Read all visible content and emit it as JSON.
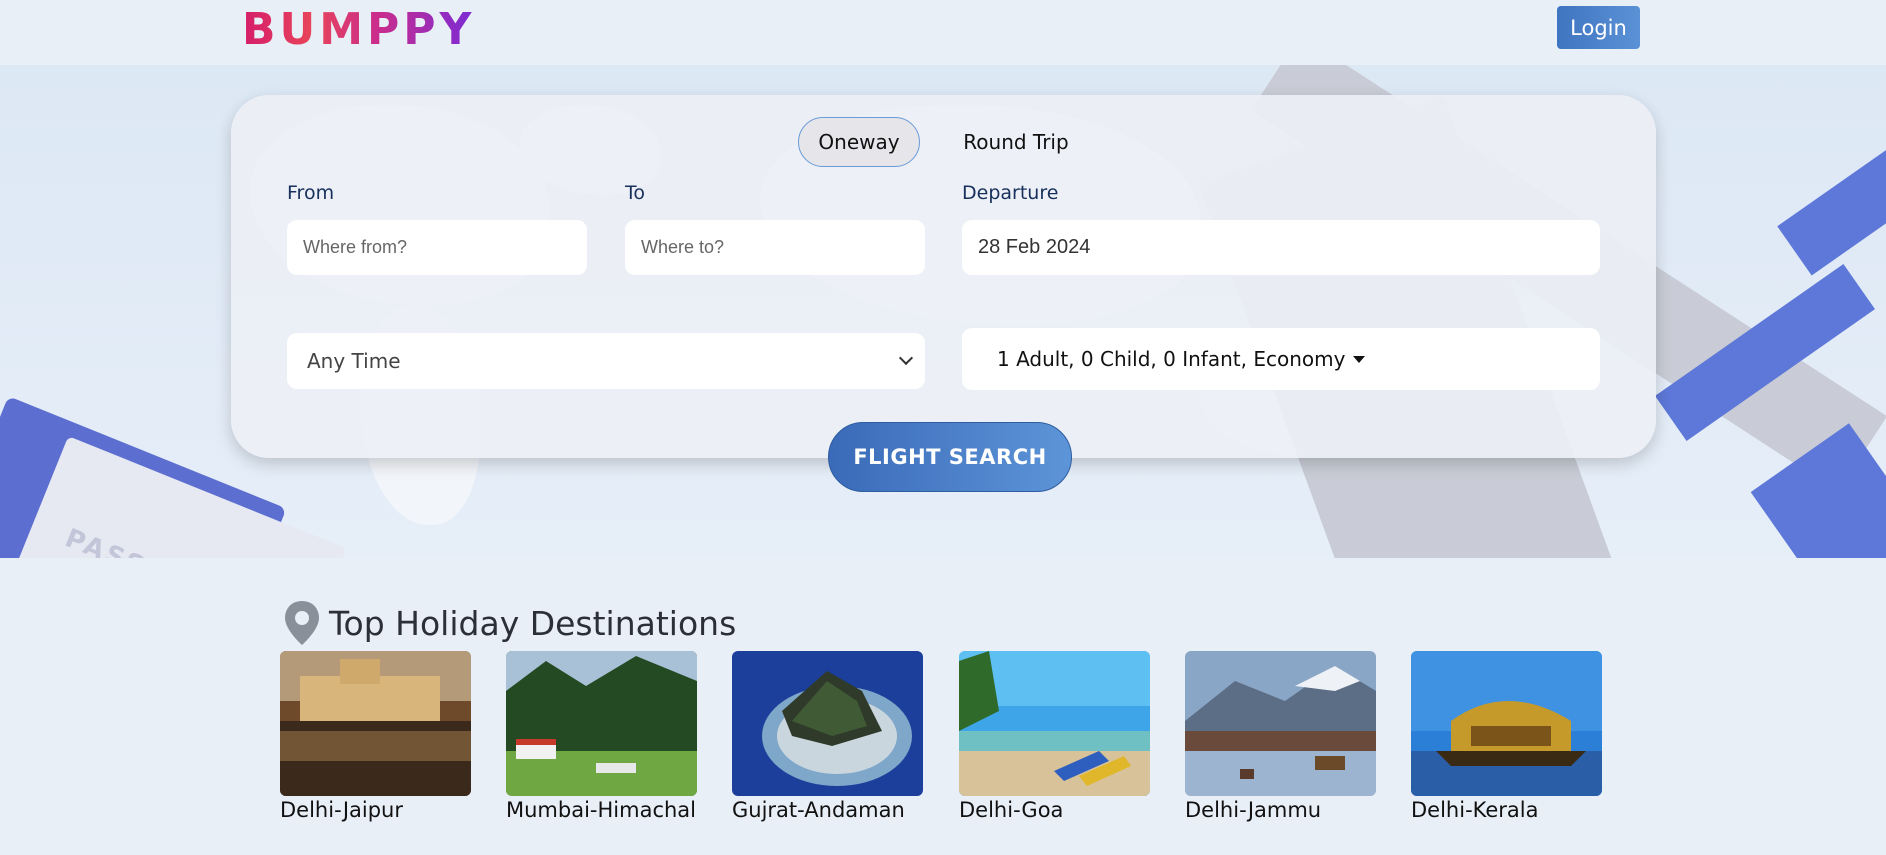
{
  "header": {
    "logo_text": "BUMPPY",
    "login_label": "Login"
  },
  "search": {
    "trip_types": [
      "Oneway",
      "Round Trip"
    ],
    "active_trip_type": "Oneway",
    "from_label": "From",
    "from_placeholder": "Where from?",
    "to_label": "To",
    "to_placeholder": "Where to?",
    "departure_label": "Departure",
    "departure_value": "28 Feb 2024",
    "time_value": "Any Time",
    "passengers_value": "1 Adult, 0 Child, 0 Infant, Economy",
    "search_button": "FLIGHT SEARCH"
  },
  "destinations": {
    "title": "Top Holiday Destinations",
    "items": [
      {
        "name": "Delhi-Jaipur"
      },
      {
        "name": "Mumbai-Himachal"
      },
      {
        "name": "Gujrat-Andaman"
      },
      {
        "name": "Delhi-Goa"
      },
      {
        "name": "Delhi-Jammu"
      },
      {
        "name": "Delhi-Kerala"
      }
    ]
  },
  "colors": {
    "accent": "#4a7fc8",
    "label": "#17305c",
    "background": "#e9eff7"
  }
}
